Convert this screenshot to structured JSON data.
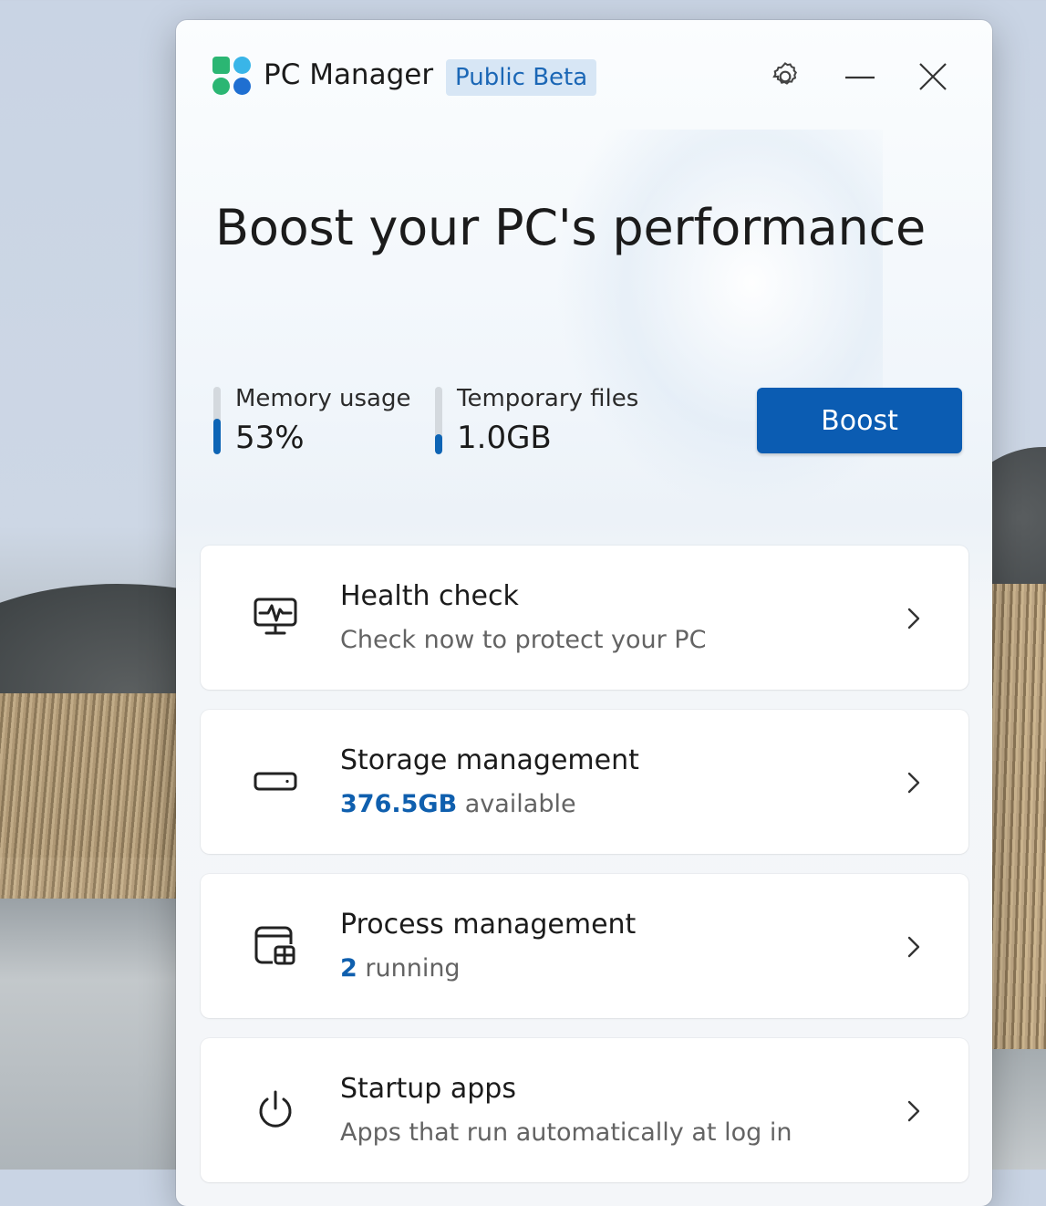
{
  "app": {
    "title": "PC Manager",
    "badge": "Public Beta",
    "colors": {
      "accent": "#0b5cb2",
      "badge_bg": "#d7e6f5",
      "badge_text": "#1b67b6"
    }
  },
  "titlebar": {
    "settings_icon": "gear-icon",
    "minimize_icon": "minimize-icon",
    "close_icon": "close-icon"
  },
  "hero": {
    "headline": "Boost your PC's performance"
  },
  "stats": {
    "memory": {
      "label": "Memory usage",
      "value": "53%",
      "fill_fraction": 0.53
    },
    "temp_files": {
      "label": "Temporary files",
      "value": "1.0GB",
      "fill_fraction": 0.3
    }
  },
  "boost_button": {
    "label": "Boost"
  },
  "cards": [
    {
      "title": "Health check",
      "subtitle": "Check now to protect your PC",
      "icon": "monitor-pulse-icon"
    },
    {
      "title": "Storage management",
      "subtitle_number": "376.5GB",
      "subtitle_rest": " available",
      "icon": "drive-icon"
    },
    {
      "title": "Process management",
      "subtitle_number": "2",
      "subtitle_rest": " running",
      "icon": "app-window-icon"
    },
    {
      "title": "Startup apps",
      "subtitle": "Apps that run automatically at log in",
      "icon": "power-icon"
    }
  ]
}
